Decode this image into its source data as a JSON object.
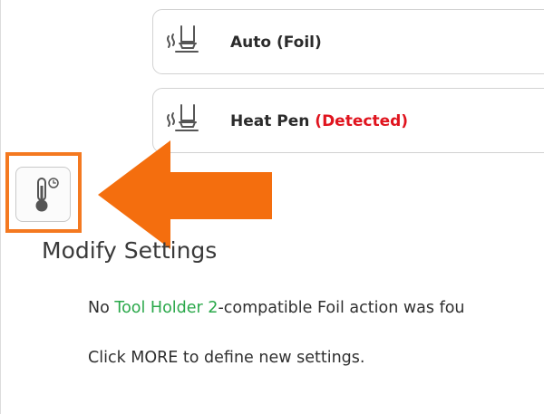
{
  "tools": [
    {
      "icon": "heat-pen-tool-icon",
      "label": "Auto (Foil)",
      "status": ""
    },
    {
      "icon": "heat-pen-tool-icon",
      "label": "Heat Pen",
      "status": "(Detected)"
    }
  ],
  "temperature_button": {
    "icon": "thermometer-clock-icon"
  },
  "annotation": {
    "highlight_color": "#f47920",
    "arrow_icon": "arrow-left-icon",
    "arrow_color": "#f46e0e"
  },
  "settings": {
    "title": "Modify Settings",
    "message1_prefix": "No ",
    "message1_tool": "Tool Holder 2",
    "message1_suffix": "-compatible Foil action was fou",
    "message2": "Click MORE to define new settings."
  },
  "colors": {
    "detected": "#e0141e",
    "tool_name": "#2aa84a"
  }
}
